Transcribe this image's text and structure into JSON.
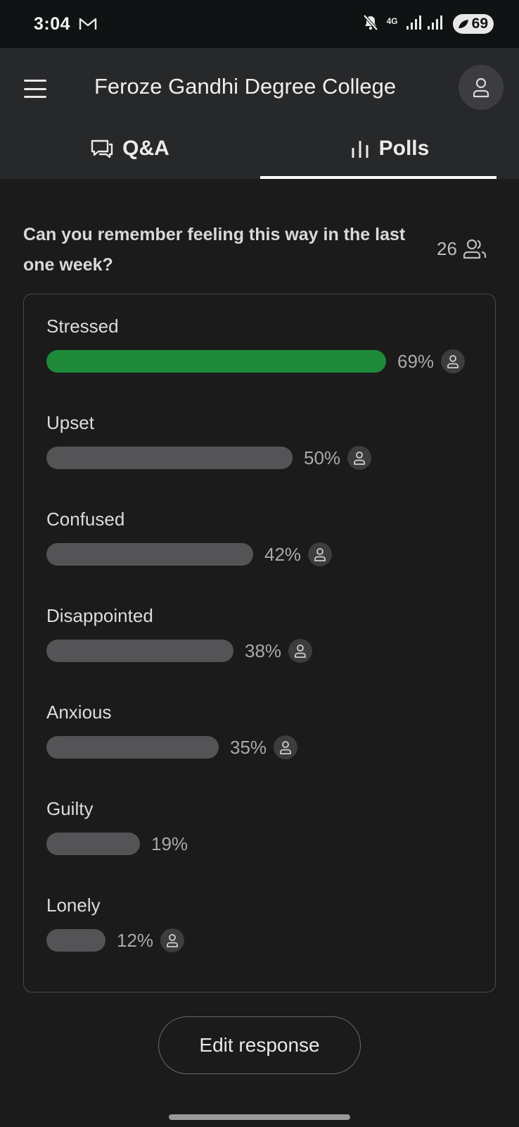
{
  "status_bar": {
    "time": "3:04",
    "network": "4G",
    "battery": "69",
    "icons": [
      "gmail-icon",
      "mute-icon",
      "signal-icon",
      "battery-icon"
    ]
  },
  "header": {
    "title": "Feroze Gandhi Degree College",
    "tabs": [
      {
        "label": "Q&A",
        "icon": "chat-bubbles-icon",
        "active": false
      },
      {
        "label": "Polls",
        "icon": "bar-chart-icon",
        "active": true
      }
    ]
  },
  "poll": {
    "question": "Can you remember feeling this way in the last one week?",
    "voter_count": "26",
    "accent_color": "#1f8a3a",
    "options": [
      {
        "label": "Stressed",
        "percent": "69%",
        "value": 69,
        "selected": true,
        "has_voter_icon": true
      },
      {
        "label": "Upset",
        "percent": "50%",
        "value": 50,
        "selected": false,
        "has_voter_icon": true
      },
      {
        "label": "Confused",
        "percent": "42%",
        "value": 42,
        "selected": false,
        "has_voter_icon": true
      },
      {
        "label": "Disappointed",
        "percent": "38%",
        "value": 38,
        "selected": false,
        "has_voter_icon": true
      },
      {
        "label": "Anxious",
        "percent": "35%",
        "value": 35,
        "selected": false,
        "has_voter_icon": true
      },
      {
        "label": "Guilty",
        "percent": "19%",
        "value": 19,
        "selected": false,
        "has_voter_icon": false
      },
      {
        "label": "Lonely",
        "percent": "12%",
        "value": 12,
        "selected": false,
        "has_voter_icon": true
      }
    ]
  },
  "actions": {
    "edit_label": "Edit response"
  }
}
